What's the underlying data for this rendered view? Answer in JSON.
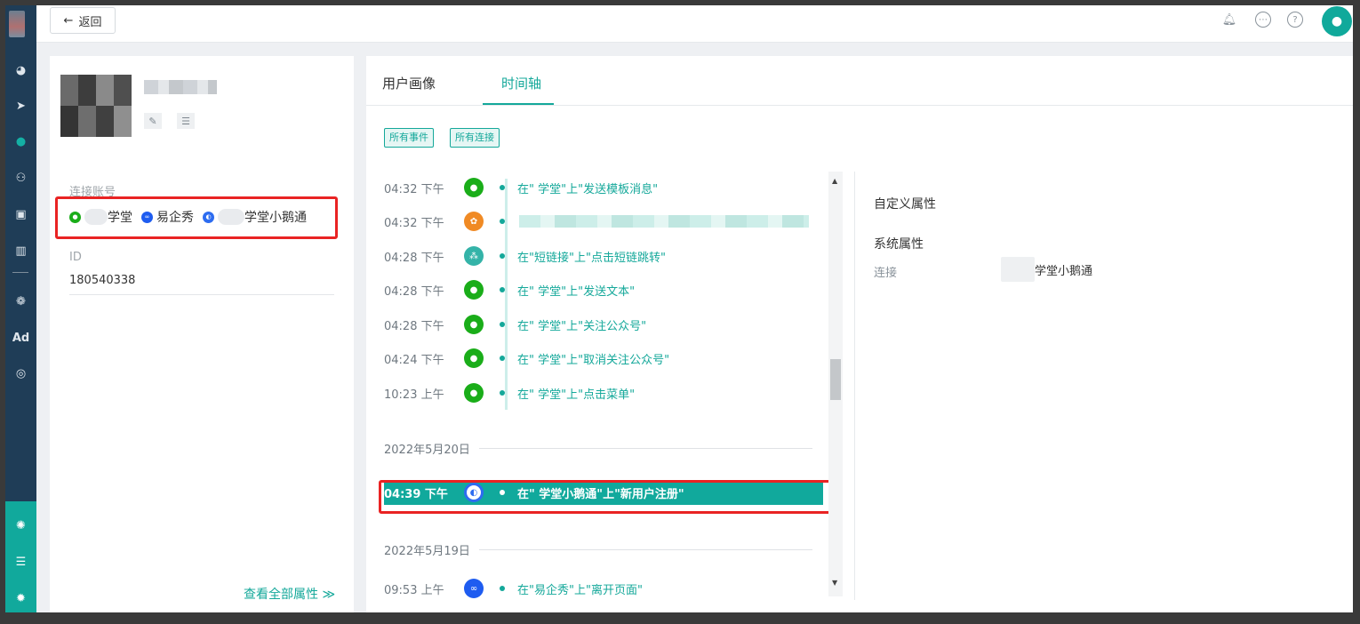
{
  "header": {
    "back_label": "返回",
    "back_arrow": "←"
  },
  "sidebar": {
    "icons": [
      "dashboard-icon",
      "send-icon",
      "user-icon",
      "users-icon",
      "badge-icon",
      "chart-icon",
      "wechat-icon",
      "ad-icon",
      "target-icon",
      "hub-icon",
      "server-icon",
      "settings-icon"
    ],
    "ad_label": "Ad"
  },
  "profile": {
    "connected_accounts_label": "连接账号",
    "accounts": [
      {
        "name": "学堂",
        "icon": "wechat-icon",
        "color": "#1aad19"
      },
      {
        "name": "易企秀",
        "icon": "eqxiu-icon",
        "color": "#1e5cf0"
      },
      {
        "name": "学堂小鹅通",
        "icon": "xiaoe-icon",
        "color": "#2d6cf0"
      }
    ],
    "id_label": "ID",
    "id_value": "180540338",
    "view_all_label": "查看全部属性 ≫"
  },
  "tabs": [
    {
      "label": "用户画像",
      "active": false
    },
    {
      "label": "时间轴",
      "active": true
    }
  ],
  "filters": [
    "所有事件",
    "所有连接"
  ],
  "timeline": {
    "groups": [
      {
        "date": "",
        "events": [
          {
            "time": "04:32 下午",
            "icon": "wechat-icon",
            "color": "#1aad19",
            "text": "在\"   学堂\"上\"发送模板消息\""
          },
          {
            "time": "04:32 下午",
            "icon": "plant-icon",
            "color": "#f08a24",
            "text": ""
          },
          {
            "time": "04:28 下午",
            "icon": "shortlink-icon",
            "color": "#34b3a8",
            "text": "在\"短链接\"上\"点击短链跳转\""
          },
          {
            "time": "04:28 下午",
            "icon": "wechat-icon",
            "color": "#1aad19",
            "text": "在\"   学堂\"上\"发送文本\""
          },
          {
            "time": "04:28 下午",
            "icon": "wechat-icon",
            "color": "#1aad19",
            "text": "在\"   学堂\"上\"关注公众号\""
          },
          {
            "time": "04:24 下午",
            "icon": "wechat-icon",
            "color": "#1aad19",
            "text": "在\"   学堂\"上\"取消关注公众号\""
          },
          {
            "time": "10:23 上午",
            "icon": "wechat-icon",
            "color": "#1aad19",
            "text": "在\"   学堂\"上\"点击菜单\""
          }
        ]
      },
      {
        "date": "2022年5月20日",
        "events": [
          {
            "time": "04:39 下午",
            "icon": "xiaoe-icon",
            "color": "#2d6cf0",
            "text": "在\"   学堂小鹅通\"上\"新用户注册\"",
            "highlighted": true
          }
        ]
      },
      {
        "date": "2022年5月19日",
        "events": [
          {
            "time": "09:53 上午",
            "icon": "eqxiu-icon",
            "color": "#1e5cf0",
            "text": "在\"易企秀\"上\"离开页面\""
          }
        ]
      }
    ]
  },
  "attributes": {
    "custom_title": "自定义属性",
    "system_title": "系统属性",
    "connection_key": "连接",
    "connection_value": "学堂小鹅通"
  },
  "colors": {
    "accent": "#14a89a",
    "highlight_bg": "#11a99c",
    "sidebar_bg": "#1f3d57",
    "annotation_red": "#e92323"
  }
}
